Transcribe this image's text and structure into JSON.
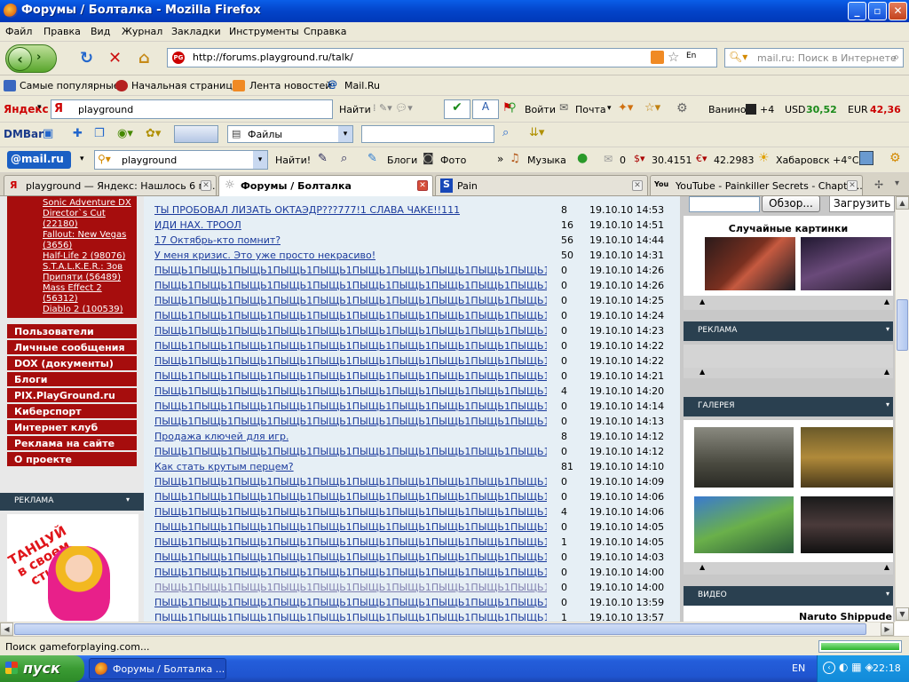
{
  "window": {
    "title": "Форумы / Болталка - Mozilla Firefox"
  },
  "menu": [
    "Файл",
    "Правка",
    "Вид",
    "Журнал",
    "Закладки",
    "Инструменты",
    "Справка"
  ],
  "nav": {
    "url": "http://forums.playground.ru/talk/",
    "search_placeholder": "mail.ru: Поиск в Интернете",
    "lang": "En"
  },
  "bookmarks": [
    "Самые популярные",
    "Начальная страница",
    "Лента новостей",
    "Mail.Ru"
  ],
  "yandex": {
    "logo": "Яндекс",
    "query": "playground",
    "find": "Найти",
    "login": "Войти",
    "mail": "Почта",
    "city": "Ванино",
    "temp": "+4",
    "usd_label": "USD",
    "usd": "30,52",
    "eur_label": "EUR",
    "eur": "42,36"
  },
  "dmbar": {
    "logo": "DMBar",
    "files": "Файлы"
  },
  "mailru": {
    "logo": "@mail.ru",
    "query": "playground",
    "find": "Найти!",
    "blogs": "Блоги",
    "photo": "Фото",
    "music": "Музыка",
    "count": "0",
    "usd": "30.4151",
    "eur": "42.2983",
    "weather": "Хабаровск +4°C"
  },
  "tabs": [
    {
      "title": "playground — Яндекс: Нашлось 6 мл...",
      "icon": "Я"
    },
    {
      "title": "Форумы / Болталка",
      "icon": "☼"
    },
    {
      "title": "Pain",
      "icon": "S"
    },
    {
      "title": "YouTube - Painkiller Secrets - Chapter...",
      "icon": "You"
    }
  ],
  "left": {
    "games": [
      "Sonic Adventure DX",
      "Director`s Cut",
      "(22180)",
      "Fallout: New Vegas",
      "(3656)",
      "Half-Life 2 (98076)",
      "S.T.A.L.K.E.R.: Зов",
      "Припяти (56489)",
      "Mass Effect 2",
      "(56312)",
      "Diablo 2 (100539)"
    ],
    "nav": [
      "Пользователи",
      "Личные сообщения",
      "DOX (документы)",
      "Блоги",
      "PIX.PlayGround.ru",
      "Киберспорт",
      "Интернет клуб",
      "Реклама на сайте",
      "О проекте"
    ],
    "ad_header": "РЕКЛАМА",
    "ad_text": "ТАНЦУЙ в своем стиле"
  },
  "topics": [
    {
      "t": "ТЫ ПРОБОВАЛ ЛИЗАТЬ ОКТАЭДР???777!1 СЛАВА ЧАКЕ!!111",
      "c": "8",
      "d": "19.10.10 14:53"
    },
    {
      "t": "ИДИ НАХ. ТРООЛ",
      "c": "16",
      "d": "19.10.10 14:51"
    },
    {
      "t": "17 Октябрь-кто помнит?",
      "c": "56",
      "d": "19.10.10 14:44"
    },
    {
      "t": "У меня кризис. Это уже просто некрасиво!",
      "c": "50",
      "d": "19.10.10 14:31"
    },
    {
      "t": "ПЫЩЬ1ПЫЩЬ1ПЫЩЬ1ПЫЩЬ1ПЫЩЬ1ПЫЩЬ1ПЫЩЬ1ПЫЩЬ1ПЫЩЬ1ПЫЩЬ1",
      "c": "0",
      "d": "19.10.10 14:26"
    },
    {
      "t": "ПЫЩЬ1ПЫЩЬ1ПЫЩЬ1ПЫЩЬ1ПЫЩЬ1ПЫЩЬ1ПЫЩЬ1ПЫЩЬ1ПЫЩЬ1ПЫЩЬ1",
      "c": "0",
      "d": "19.10.10 14:26"
    },
    {
      "t": "ПЫЩЬ1ПЫЩЬ1ПЫЩЬ1ПЫЩЬ1ПЫЩЬ1ПЫЩЬ1ПЫЩЬ1ПЫЩЬ1ПЫЩЬ1ПЫЩЬ1",
      "c": "0",
      "d": "19.10.10 14:25"
    },
    {
      "t": "ПЫЩЬ1ПЫЩЬ1ПЫЩЬ1ПЫЩЬ1ПЫЩЬ1ПЫЩЬ1ПЫЩЬ1ПЫЩЬ1ПЫЩЬ1ПЫЩЬ1",
      "c": "0",
      "d": "19.10.10 14:24"
    },
    {
      "t": "ПЫЩЬ1ПЫЩЬ1ПЫЩЬ1ПЫЩЬ1ПЫЩЬ1ПЫЩЬ1ПЫЩЬ1ПЫЩЬ1ПЫЩЬ1ПЫЩЬ1",
      "c": "0",
      "d": "19.10.10 14:23"
    },
    {
      "t": "ПЫЩЬ1ПЫЩЬ1ПЫЩЬ1ПЫЩЬ1ПЫЩЬ1ПЫЩЬ1ПЫЩЬ1ПЫЩЬ1ПЫЩЬ1ПЫЩЬ1",
      "c": "0",
      "d": "19.10.10 14:22"
    },
    {
      "t": "ПЫЩЬ1ПЫЩЬ1ПЫЩЬ1ПЫЩЬ1ПЫЩЬ1ПЫЩЬ1ПЫЩЬ1ПЫЩЬ1ПЫЩЬ1ПЫЩЬ1",
      "c": "0",
      "d": "19.10.10 14:22"
    },
    {
      "t": "ПЫЩЬ1ПЫЩЬ1ПЫЩЬ1ПЫЩЬ1ПЫЩЬ1ПЫЩЬ1ПЫЩЬ1ПЫЩЬ1ПЫЩЬ1ПЫЩЬ1",
      "c": "0",
      "d": "19.10.10 14:21"
    },
    {
      "t": "ПЫЩЬ1ПЫЩЬ1ПЫЩЬ1ПЫЩЬ1ПЫЩЬ1ПЫЩЬ1ПЫЩЬ1ПЫЩЬ1ПЫЩЬ1ПЫЩЬ1",
      "c": "4",
      "d": "19.10.10 14:20"
    },
    {
      "t": "ПЫЩЬ1ПЫЩЬ1ПЫЩЬ1ПЫЩЬ1ПЫЩЬ1ПЫЩЬ1ПЫЩЬ1ПЫЩЬ1ПЫЩЬ1ПЫЩЬ1",
      "c": "0",
      "d": "19.10.10 14:14"
    },
    {
      "t": "ПЫЩЬ1ПЫЩЬ1ПЫЩЬ1ПЫЩЬ1ПЫЩЬ1ПЫЩЬ1ПЫЩЬ1ПЫЩЬ1ПЫЩЬ1ПЫЩЬ1",
      "c": "0",
      "d": "19.10.10 14:13"
    },
    {
      "t": "Продажа ключей для игр.",
      "c": "8",
      "d": "19.10.10 14:12"
    },
    {
      "t": "ПЫЩЬ1ПЫЩЬ1ПЫЩЬ1ПЫЩЬ1ПЫЩЬ1ПЫЩЬ1ПЫЩЬ1ПЫЩЬ1ПЫЩЬ1ПЫЩЬ1",
      "c": "0",
      "d": "19.10.10 14:12"
    },
    {
      "t": "Как стать крутым перцем?",
      "c": "81",
      "d": "19.10.10 14:10"
    },
    {
      "t": "ПЫЩЬ1ПЫЩЬ1ПЫЩЬ1ПЫЩЬ1ПЫЩЬ1ПЫЩЬ1ПЫЩЬ1ПЫЩЬ1ПЫЩЬ1ПЫЩЬ1",
      "c": "0",
      "d": "19.10.10 14:09"
    },
    {
      "t": "ПЫЩЬ1ПЫЩЬ1ПЫЩЬ1ПЫЩЬ1ПЫЩЬ1ПЫЩЬ1ПЫЩЬ1ПЫЩЬ1ПЫЩЬ1ПЫЩЬ1",
      "c": "0",
      "d": "19.10.10 14:06"
    },
    {
      "t": "ПЫЩЬ1ПЫЩЬ1ПЫЩЬ1ПЫЩЬ1ПЫЩЬ1ПЫЩЬ1ПЫЩЬ1ПЫЩЬ1ПЫЩЬ1ПЫЩЬ1",
      "c": "4",
      "d": "19.10.10 14:06"
    },
    {
      "t": "ПЫЩЬ1ПЫЩЬ1ПЫЩЬ1ПЫЩЬ1ПЫЩЬ1ПЫЩЬ1ПЫЩЬ1ПЫЩЬ1ПЫЩЬ1ПЫЩЬ1",
      "c": "0",
      "d": "19.10.10 14:05"
    },
    {
      "t": "ПЫЩЬ1ПЫЩЬ1ПЫЩЬ1ПЫЩЬ1ПЫЩЬ1ПЫЩЬ1ПЫЩЬ1ПЫЩЬ1ПЫЩЬ1ПЫЩЬ1",
      "c": "1",
      "d": "19.10.10 14:05"
    },
    {
      "t": "ПЫЩЬ1ПЫЩЬ1ПЫЩЬ1ПЫЩЬ1ПЫЩЬ1ПЫЩЬ1ПЫЩЬ1ПЫЩЬ1ПЫЩЬ1ПЫЩЬ1",
      "c": "0",
      "d": "19.10.10 14:03"
    },
    {
      "t": "ПЫЩЬ1ПЫЩЬ1ПЫЩЬ1ПЫЩЬ1ПЫЩЬ1ПЫЩЬ1ПЫЩЬ1ПЫЩЬ1ПЫЩЬ1ПЫЩЬ1",
      "c": "0",
      "d": "19.10.10 14:00"
    },
    {
      "t": "ПЫЩЬ1ПЫЩЬ1ПЫЩЬ1ПЫЩЬ1ПЫЩЬ1ПЫЩЬ1ПЫЩЬ1ПЫЩЬ1ПЫЩЬ1ПЫЩЬ1",
      "c": "0",
      "d": "19.10.10 14:00"
    },
    {
      "t": "ПЫЩЬ1ПЫЩЬ1ПЫЩЬ1ПЫЩЬ1ПЫЩЬ1ПЫЩЬ1ПЫЩЬ1ПЫЩЬ1ПЫЩЬ1ПЫЩЬ1",
      "c": "0",
      "d": "19.10.10 13:59"
    },
    {
      "t": "ПЫЩЬ1ПЫЩЬ1ПЫЩЬ1ПЫЩЬ1ПЫЩЬ1ПЫЩЬ1ПЫЩЬ1ПЫЩЬ1ПЫЩЬ1ПЫЩЬ1",
      "c": "1",
      "d": "19.10.10 13:57"
    }
  ],
  "right": {
    "browse": "Обзор...",
    "upload": "Загрузить",
    "random": "Случайные картинки",
    "ads": "РЕКЛАМА",
    "gallery": "ГАЛЕРЕЯ",
    "video": "ВИДЕО",
    "video_title": "Naruto Shippude"
  },
  "status": "Поиск gameforplaying.com...",
  "taskbar": {
    "start": "пуск",
    "item": "Форумы / Болталка ...",
    "lang": "EN",
    "time": "22:18"
  }
}
